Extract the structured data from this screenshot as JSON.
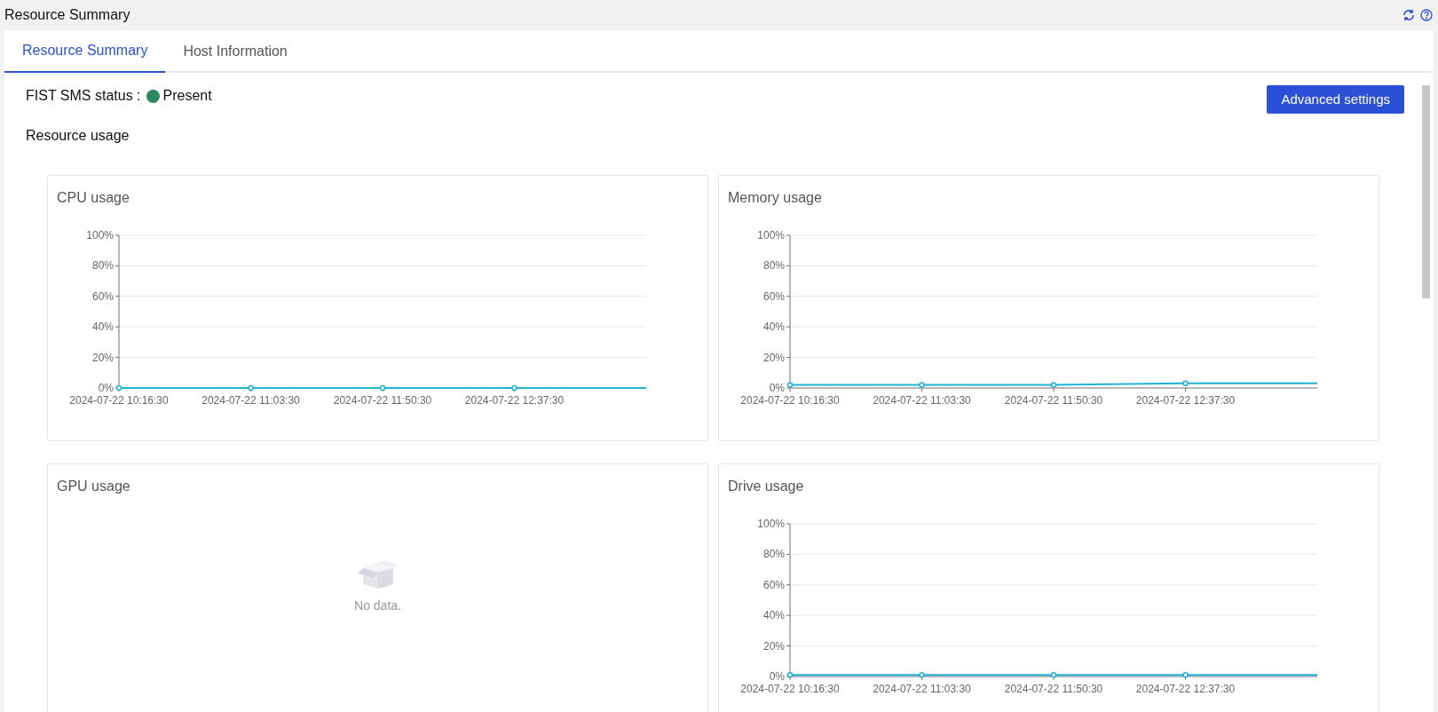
{
  "header": {
    "title": "Resource Summary"
  },
  "tabs": [
    {
      "label": "Resource Summary",
      "selected": true
    },
    {
      "label": "Host Information",
      "selected": false
    }
  ],
  "status": {
    "label": "FIST SMS status :",
    "value": "Present",
    "color": "#2a8a5e"
  },
  "advanced_button": "Advanced settings",
  "section_title": "Resource usage",
  "cards": [
    {
      "title": "CPU usage",
      "kind": "chart",
      "chart_data": {
        "type": "line",
        "grid": true,
        "categories": [
          "2024-07-22 10:16:30",
          "2024-07-22 11:03:30",
          "2024-07-22 11:50:30",
          "2024-07-22 12:37:30",
          null
        ],
        "series": [
          {
            "color": "#1fb3d6",
            "marker": true,
            "values": [
              0,
              0,
              0,
              0,
              0
            ]
          }
        ],
        "ylim": [
          0,
          100
        ],
        "yticks": [
          {
            "value": 0,
            "label": "0%"
          },
          {
            "value": 20,
            "label": "20%"
          },
          {
            "value": 40,
            "label": "40%"
          },
          {
            "value": 60,
            "label": "60%"
          },
          {
            "value": 80,
            "label": "80%"
          },
          {
            "value": 100,
            "label": "100%"
          }
        ]
      }
    },
    {
      "title": "Memory usage",
      "kind": "chart",
      "chart_data": {
        "type": "line",
        "grid": true,
        "categories": [
          "2024-07-22 10:16:30",
          "2024-07-22 11:03:30",
          "2024-07-22 11:50:30",
          "2024-07-22 12:37:30",
          null
        ],
        "series": [
          {
            "color": "#1fb3d6",
            "marker": true,
            "values": [
              2,
              2,
              2,
              3,
              3
            ]
          }
        ],
        "ylim": [
          0,
          100
        ],
        "yticks": [
          {
            "value": 0,
            "label": "0%"
          },
          {
            "value": 20,
            "label": "20%"
          },
          {
            "value": 40,
            "label": "40%"
          },
          {
            "value": 60,
            "label": "60%"
          },
          {
            "value": 80,
            "label": "80%"
          },
          {
            "value": 100,
            "label": "100%"
          }
        ]
      }
    },
    {
      "title": "GPU usage",
      "kind": "empty",
      "empty_text": "No data."
    },
    {
      "title": "Drive usage",
      "kind": "chart",
      "chart_data": {
        "type": "line",
        "grid": true,
        "categories": [
          "2024-07-22 10:16:30",
          "2024-07-22 11:03:30",
          "2024-07-22 11:50:30",
          "2024-07-22 12:37:30",
          null
        ],
        "series": [
          {
            "color": "#1fb3d6",
            "marker": true,
            "values": [
              1,
              1,
              1,
              1,
              1
            ]
          }
        ],
        "ylim": [
          0,
          100
        ],
        "yticks": [
          {
            "value": 0,
            "label": "0%"
          },
          {
            "value": 20,
            "label": "20%"
          },
          {
            "value": 40,
            "label": "40%"
          },
          {
            "value": 60,
            "label": "60%"
          },
          {
            "value": 80,
            "label": "80%"
          },
          {
            "value": 100,
            "label": "100%"
          }
        ]
      }
    }
  ]
}
